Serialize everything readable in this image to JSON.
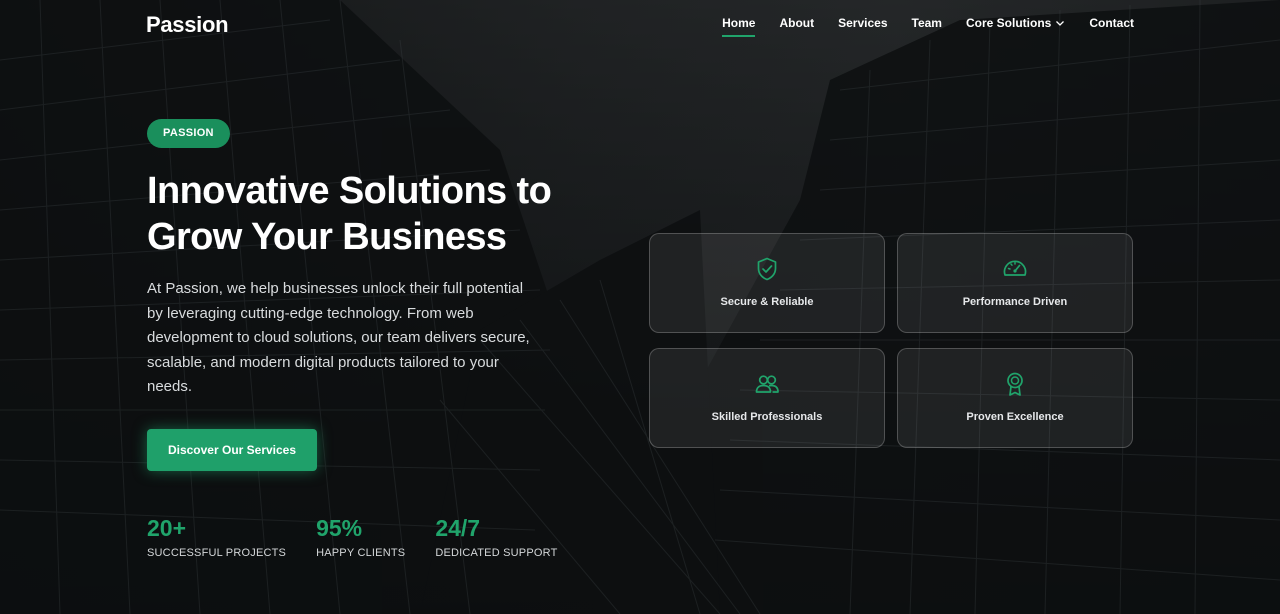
{
  "brand": {
    "logo": "Passion",
    "accent": "#20a46b"
  },
  "nav": {
    "items": [
      {
        "label": "Home",
        "active": true
      },
      {
        "label": "About"
      },
      {
        "label": "Services"
      },
      {
        "label": "Team"
      },
      {
        "label": "Core Solutions",
        "has_dropdown": true
      },
      {
        "label": "Contact"
      }
    ]
  },
  "hero": {
    "badge": "PASSION",
    "headline_line1": "Innovative Solutions to",
    "headline_line2": "Grow Your Business",
    "description": "At Passion, we help businesses unlock their full potential by leveraging cutting-edge technology. From web development to cloud solutions, our team delivers secure, scalable, and modern digital products tailored to your needs.",
    "cta_label": "Discover Our Services"
  },
  "stats": [
    {
      "value": "20+",
      "label": "SUCCESSFUL PROJECTS"
    },
    {
      "value": "95%",
      "label": "HAPPY CLIENTS"
    },
    {
      "value": "24/7",
      "label": "DEDICATED SUPPORT"
    }
  ],
  "features": [
    {
      "icon": "shield-check-icon",
      "label": "Secure & Reliable"
    },
    {
      "icon": "speedometer-icon",
      "label": "Performance Driven"
    },
    {
      "icon": "people-icon",
      "label": "Skilled Professionals"
    },
    {
      "icon": "award-icon",
      "label": "Proven Excellence"
    }
  ]
}
